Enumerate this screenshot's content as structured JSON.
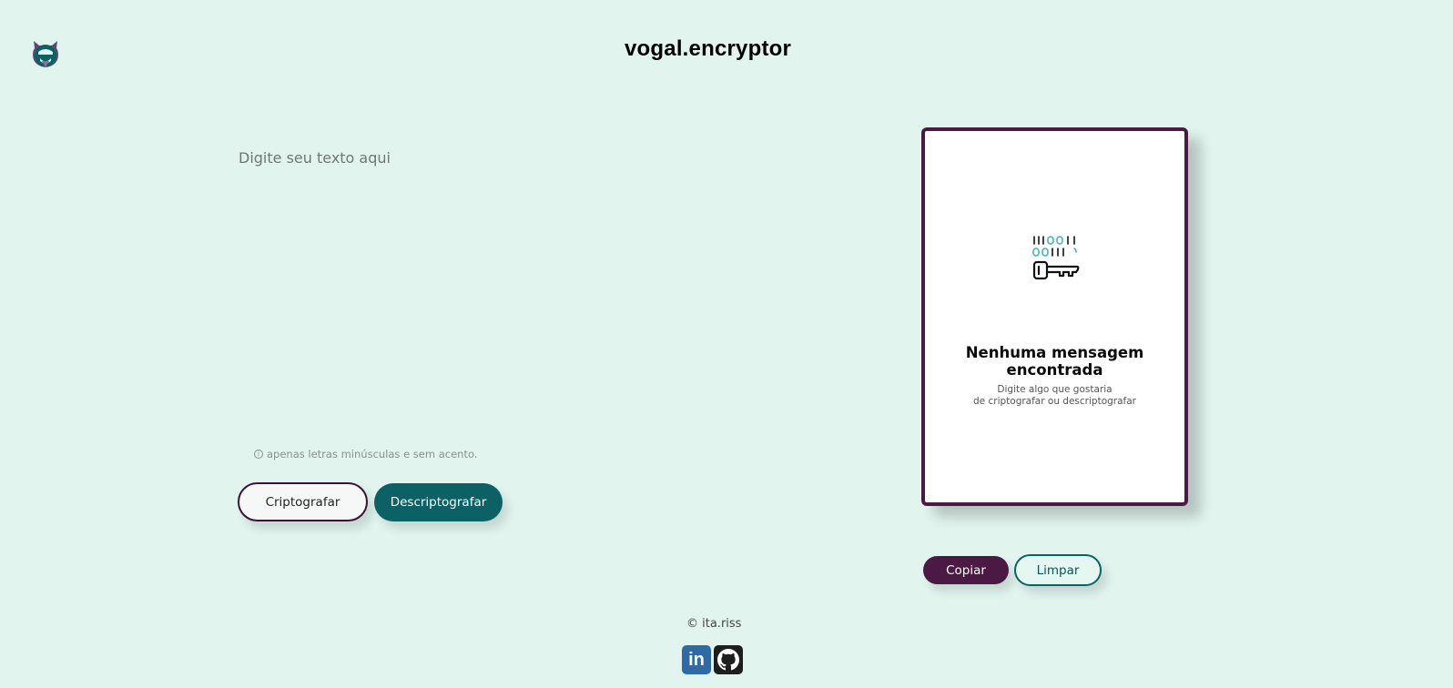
{
  "app": {
    "title": "vogal.encryptor",
    "logo_icon": "alura-logo-icon"
  },
  "input": {
    "placeholder": "Digite seu texto aqui",
    "value": "",
    "hint": "apenas letras minúsculas e sem acento.",
    "hint_icon": "info-icon"
  },
  "actions": {
    "encrypt_label": "Criptografar",
    "decrypt_label": "Descriptografar"
  },
  "output": {
    "icon": "binary-key-icon",
    "empty_title": "Nenhuma mensagem encontrada",
    "empty_subtitle_line1": "Digite algo que gostaria",
    "empty_subtitle_line2": "de criptografar ou descriptografar",
    "copy_label": "Copiar",
    "clear_label": "Limpar"
  },
  "footer": {
    "copyright": "© ita.riss",
    "social": [
      {
        "name": "linkedin",
        "icon": "linkedin-icon",
        "label": "in"
      },
      {
        "name": "github",
        "icon": "github-icon"
      }
    ]
  },
  "colors": {
    "background": "#e1f4ee",
    "primary_purple": "#4b1a44",
    "primary_teal": "#0b6163"
  }
}
